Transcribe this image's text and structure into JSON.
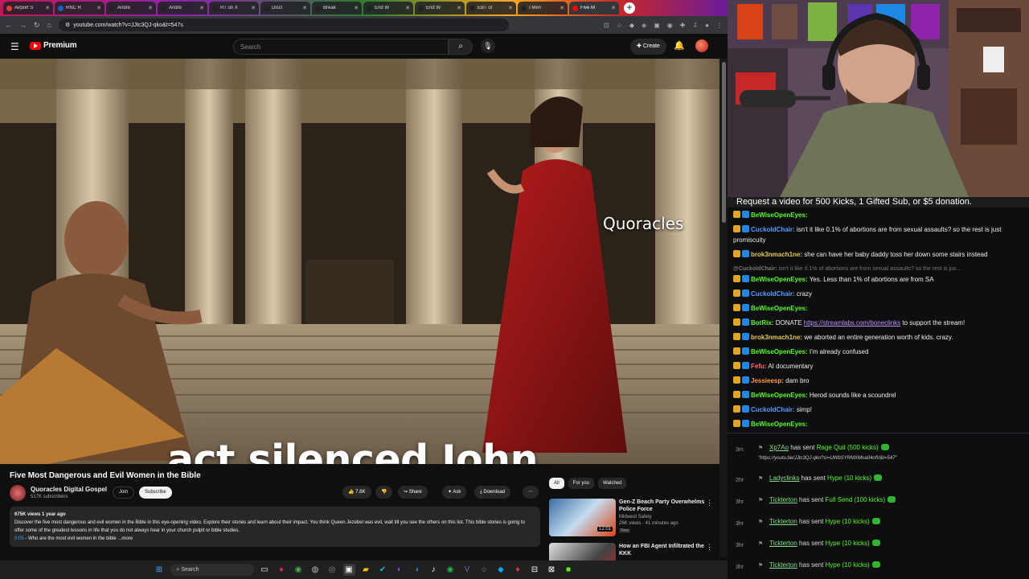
{
  "browser": {
    "tabs": [
      {
        "label": "Airport S",
        "color": "#e53935"
      },
      {
        "label": "RNC R",
        "color": "#1565c0"
      },
      {
        "label": "Andre",
        "color": "#222"
      },
      {
        "label": "Andre",
        "color": "#222"
      },
      {
        "label": "RT on X",
        "color": "#222"
      },
      {
        "label": "Discl",
        "color": "#222"
      },
      {
        "label": "Break",
        "color": "#222"
      },
      {
        "label": "End W",
        "color": "#222"
      },
      {
        "label": "End W",
        "color": "#222"
      },
      {
        "label": "EBT of",
        "color": "#222"
      },
      {
        "label": "I Men",
        "color": "#222"
      },
      {
        "label": "Five M",
        "color": "#ff0000"
      }
    ],
    "url": "youtube.com/watch?v=JJtc3QJ-qko&t=547s"
  },
  "youtube": {
    "logo_text": "Premium",
    "search_placeholder": "Search",
    "create_label": "Create",
    "video": {
      "watermark": "Quoracles",
      "caption": "act silenced John,",
      "title": "Five Most Dangerous and Evil Women in the Bible",
      "channel": "Quoracles Digital Gospel",
      "subscribers": "517K subscribers",
      "join": "Join",
      "subscribe": "Subscribe",
      "likes": "7.8K",
      "share": "Share",
      "ask": "Ask",
      "download": "Download",
      "description": {
        "meta": "675K views  1 year ago",
        "text": "Discover the five most dangerous and evil women in the Bible in this eye-opening video. Explore their stories and learn about their impact. You think Queen Jezebel was evil, wait till you see the others on this list. This bible stories is going to offer some of the greatest lessons in life that you do not always hear in your church pulpit or bible studies.",
        "timestamp": "0:05",
        "chapter": " - Who are the most evil women in the bible",
        "more": "...more"
      }
    },
    "filters": [
      "All",
      "For you",
      "Watched"
    ],
    "recommended": [
      {
        "title": "Gen-Z Beach Party Overwhelms Police Force",
        "channel": "Midwest Safety",
        "views": "26K views · 41 minutes ago",
        "badge": "New",
        "duration": "12:01"
      },
      {
        "title": "How an FBI Agent Infiltrated the KKK",
        "channel": "",
        "views": "",
        "badge": "",
        "duration": ""
      }
    ]
  },
  "taskbar": {
    "search": "Search"
  },
  "stream": {
    "request_banner": "Request a video for 500 Kicks, 1 Gifted Sub, or $5 donation.",
    "chat": [
      {
        "user": "BeWiseOpenEyes:",
        "text": "",
        "color": "#53fc18",
        "type": "msg"
      },
      {
        "user": "CuckoldChair:",
        "text": "isn't it like 0.1% of abortions are from sexual assaults? so the rest is just promiscuity",
        "color": "#5b9cff",
        "type": "msg"
      },
      {
        "user": "brok3nmach1ne:",
        "text": "she can have her baby daddy toss her down some stairs instead",
        "color": "#e6c84a",
        "type": "msg"
      },
      {
        "user": "@CuckoldChair:",
        "text": "isn't it like 0.1% of abortions are from sexual assaults? so the rest is jus...",
        "color": "#777",
        "type": "reply"
      },
      {
        "user": "BeWiseOpenEyes:",
        "text": "Yes. Less than 1% of abortions are from SA",
        "color": "#53fc18",
        "type": "msg"
      },
      {
        "user": "CuckoldChair:",
        "text": "crazy",
        "color": "#5b9cff",
        "type": "msg"
      },
      {
        "user": "BeWiseOpenEyes:",
        "text": "",
        "color": "#53fc18",
        "type": "msg"
      },
      {
        "user": "BotRix:",
        "text": "DONATE ",
        "link": "https://streamlabs.com/boneclinks",
        "after": " to support the stream!",
        "color": "#53fc18",
        "type": "msg"
      },
      {
        "user": "brok3nmach1ne:",
        "text": "we aborted an entire generation worth of kids. crazy.",
        "color": "#e6c84a",
        "type": "msg"
      },
      {
        "user": "BeWiseOpenEyes:",
        "text": "I'm already confused",
        "color": "#53fc18",
        "type": "msg"
      },
      {
        "user": "Fefu:",
        "text": "AI documentary",
        "color": "#ff6b6b",
        "type": "msg"
      },
      {
        "user": "Jessieesp:",
        "text": "dam bro",
        "color": "#ff9f43",
        "type": "msg"
      },
      {
        "user": "BeWiseOpenEyes:",
        "text": "Herod sounds like a scoundrel",
        "color": "#53fc18",
        "type": "msg"
      },
      {
        "user": "CuckoldChair:",
        "text": "simp!",
        "color": "#5b9cff",
        "type": "msg"
      },
      {
        "user": "BeWiseOpenEyes:",
        "text": "",
        "color": "#53fc18",
        "type": "msg"
      }
    ],
    "events": [
      {
        "age": "3m",
        "user": "Xp7Ao",
        "mid": " has sent ",
        "gift": "Rage Quit (500 kicks)",
        "note": "\"https://youtu.be/JJtc3QJ-qko?si=UWbSYRMXMna04ofV&t=547\""
      },
      {
        "age": "2hr",
        "user": "Ladyclinks",
        "mid": " has sent ",
        "gift": "Hype (10 kicks)",
        "note": ""
      },
      {
        "age": "3hr",
        "user": "Tickterton",
        "mid": " has sent ",
        "gift": "Full Send (100 kicks)",
        "note": ""
      },
      {
        "age": "3hr",
        "user": "Tickterton",
        "mid": " has sent ",
        "gift": "Hype (10 kicks)",
        "note": ""
      },
      {
        "age": "3hr",
        "user": "Tickterton",
        "mid": " has sent ",
        "gift": "Hype (10 kicks)",
        "note": ""
      },
      {
        "age": "3hr",
        "user": "Tickterton",
        "mid": " has sent ",
        "gift": "Hype (10 kicks)",
        "note": ""
      }
    ]
  }
}
